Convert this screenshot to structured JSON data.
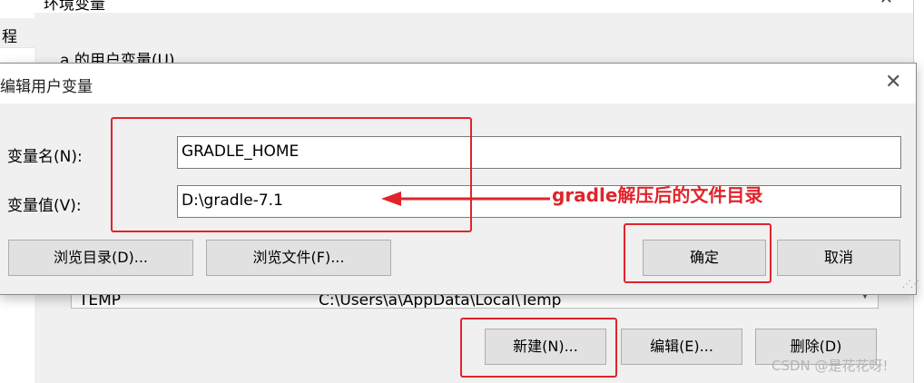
{
  "background": {
    "left_strip_text": "程",
    "window_title": "环境变量",
    "user_vars_label": "a 的用户变量(U)",
    "list_row": {
      "name": "TEMP",
      "value": "C:\\Users\\a\\AppData\\Local\\Temp"
    },
    "buttons": {
      "new": "新建(N)...",
      "edit": "编辑(E)...",
      "delete": "删除(D)"
    }
  },
  "dialog": {
    "title": "编辑用户变量",
    "var_name_label": "变量名(N):",
    "var_name_value": "GRADLE_HOME",
    "var_value_label": "变量值(V):",
    "var_value_value": "D:\\gradle-7.1",
    "buttons": {
      "browse_dir": "浏览目录(D)...",
      "browse_file": "浏览文件(F)...",
      "ok": "确定",
      "cancel": "取消"
    }
  },
  "annotation": {
    "text": "gradle解压后的文件目录",
    "color": "#e0242c"
  },
  "watermark": "CSDN @是花花呀!"
}
